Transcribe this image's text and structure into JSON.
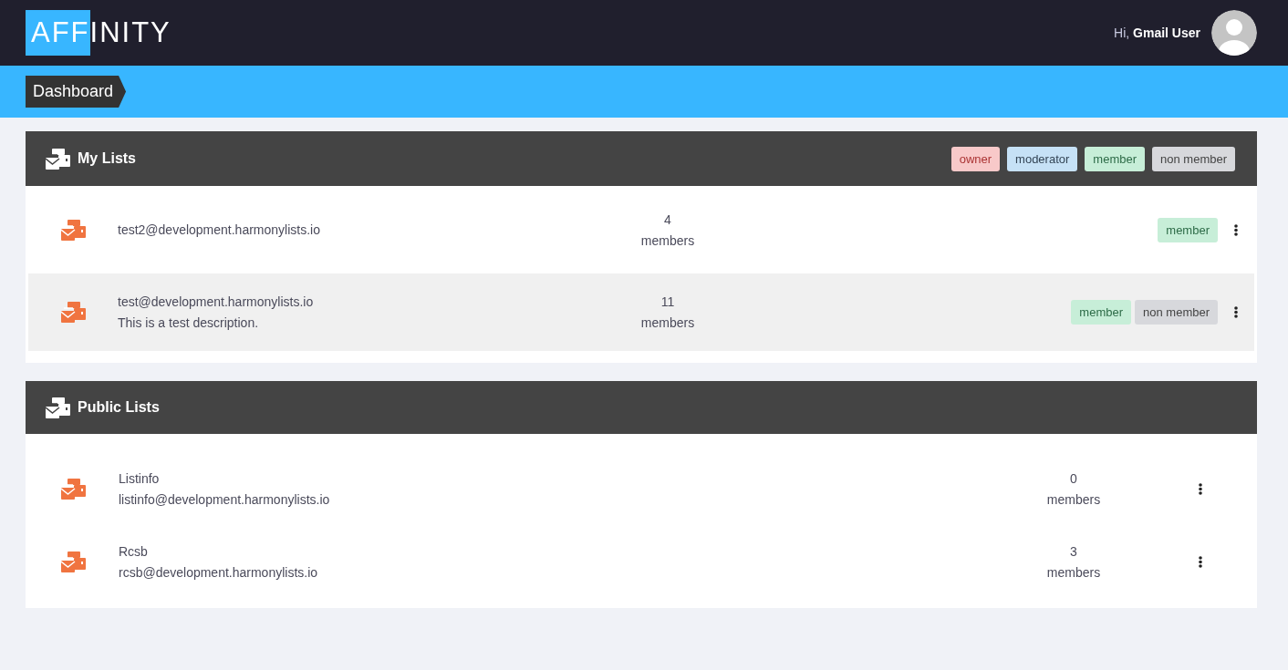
{
  "header": {
    "logo": {
      "highlighted": "AFF",
      "rest": "INITY"
    },
    "greeting": "Hi, **Gmail User**"
  },
  "breadcrumb": "Dashboard",
  "my_lists": {
    "title": "My Lists",
    "legend": [
      {
        "label": "owner",
        "kind": "owner"
      },
      {
        "label": "moderator",
        "kind": "moderator"
      },
      {
        "label": "member",
        "kind": "member"
      },
      {
        "label": "non member",
        "kind": "non_member"
      }
    ],
    "rows": [
      {
        "email": "test2@development.harmonylists.io",
        "count": "4",
        "count_label": "members",
        "selected": false,
        "roles": [
          {
            "label": "member",
            "kind": "member"
          }
        ]
      },
      {
        "email": "test@development.harmonylists.io",
        "description": "This is a test description.",
        "count": "11",
        "count_label": "members",
        "selected": true,
        "roles": [
          {
            "label": "member",
            "kind": "member"
          },
          {
            "label": "non member",
            "kind": "non_member"
          }
        ]
      }
    ]
  },
  "public_lists": {
    "title": "Public Lists",
    "rows": [
      {
        "name": "Listinfo",
        "email": "listinfo@development.harmonylists.io",
        "count": "0",
        "count_label": "members"
      },
      {
        "name": "Rcsb",
        "email": "rcsb@development.harmonylists.io",
        "count": "3",
        "count_label": "members"
      }
    ]
  }
}
